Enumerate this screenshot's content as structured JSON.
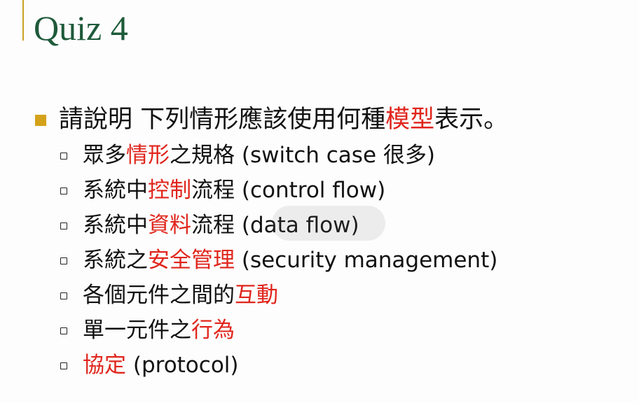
{
  "title": "Quiz 4",
  "main": {
    "pre": "請說明 下列情形應該使用何種",
    "highlight": "模型",
    "post": "表示。"
  },
  "items": [
    {
      "pre": "眾多",
      "highlight": "情形",
      "post": "之規格 (switch case 很多)"
    },
    {
      "pre": "系統中",
      "highlight": "控制",
      "post": "流程 (control flow)"
    },
    {
      "pre": "系統中",
      "highlight": "資料",
      "post": "流程 (data flow)"
    },
    {
      "pre": "系統之",
      "highlight": "安全管理",
      "post": " (security management)"
    },
    {
      "pre": "各個元件之間的",
      "highlight": "互動",
      "post": ""
    },
    {
      "pre": "單一元件之",
      "highlight": "行為",
      "post": ""
    },
    {
      "pre": "",
      "highlight": "協定",
      "post": " (protocol)"
    }
  ],
  "colors": {
    "title": "#1e5a3a",
    "accent_bar": "#c9a227",
    "main_bullet": "#d4a219",
    "highlight": "#e0251c",
    "text": "#111111"
  }
}
